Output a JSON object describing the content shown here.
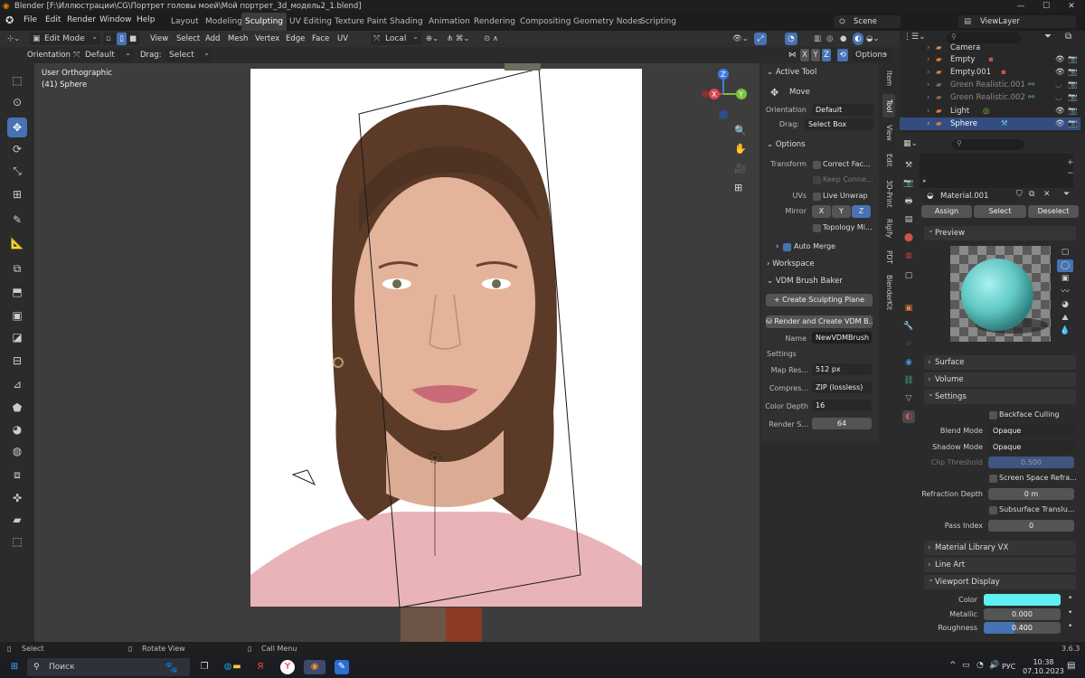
{
  "window": {
    "title": "Blender [F:\\Иллюстрации\\CG\\Портрет головы моей\\Мой портрет_3d_модель2_1.blend]",
    "minimize": "—",
    "maximize": "☐",
    "close": "✕"
  },
  "menu": [
    "File",
    "Edit",
    "Render",
    "Window",
    "Help"
  ],
  "workspaces": [
    "Layout",
    "Modeling",
    "Sculpting",
    "UV Editing",
    "Texture Paint",
    "Shading",
    "Animation",
    "Rendering",
    "Compositing",
    "Geometry Nodes",
    "Scripting"
  ],
  "active_workspace": "Sculpting",
  "scene": {
    "label": "Scene",
    "view_layer": "ViewLayer"
  },
  "header": {
    "mode": "Edit Mode",
    "menus": [
      "View",
      "Select",
      "Add",
      "Mesh",
      "Vertex",
      "Edge",
      "Face",
      "UV"
    ],
    "transform_orientation": "Local",
    "options_label": "Options",
    "axes": [
      "X",
      "Y",
      "Z"
    ]
  },
  "tool_settings": {
    "orientation_label": "Orientation:",
    "orientation_value": "Default",
    "drag_label": "Drag:",
    "drag_value": "Select Box"
  },
  "viewport": {
    "view_name": "User Orthographic",
    "object_info": "(41) Sphere"
  },
  "gizmo": {
    "x": "X",
    "y": "Y",
    "z": "Z"
  },
  "npanel": {
    "active_tool_title": "Active Tool",
    "tool_name": "Move",
    "orientation_label": "Orientation",
    "orientation_value": "Default",
    "drag_label": "Drag:",
    "drag_value": "Select Box",
    "options_title": "Options",
    "transform_label": "Transform",
    "correct_face": "Correct Fac...",
    "keep_connected": "Keep Conne...",
    "uvs_label": "UVs",
    "live_unwrap": "Live Unwrap",
    "mirror_label": "Mirror",
    "mirror_axes": [
      "X",
      "Y",
      "Z"
    ],
    "topology_mirror": "Topology Mi...",
    "auto_merge": "Auto Merge",
    "workspace_title": "Workspace",
    "vdm_title": "VDM Brush Baker",
    "create_plane": "Create Sculpting Plane",
    "render_vdm": "Render and Create VDM B...",
    "name_label": "Name",
    "name_value": "NewVDMBrush",
    "settings_label": "Settings",
    "map_res_label": "Map Res...",
    "map_res_value": "512 px",
    "compression_label": "Compres...",
    "compression_value": "ZIP (lossless)",
    "color_depth_label": "Color Depth",
    "color_depth_value": "16",
    "render_samples_label": "Render S...",
    "render_samples_value": "64"
  },
  "sidebar_tabs": [
    "Item",
    "Tool",
    "View",
    "Edit",
    "3D-Print",
    "Rigify",
    "PDT",
    "BlenderKit"
  ],
  "outliner": [
    {
      "name": "Camera",
      "color": "#c98e5a"
    },
    {
      "name": "Empty",
      "color": "#d0d0d0"
    },
    {
      "name": "Empty.001",
      "color": "#d0d0d0"
    },
    {
      "name": "Green Realistic.001",
      "color": "#8a8a8a"
    },
    {
      "name": "Green Realistic.002",
      "color": "#8a8a8a"
    },
    {
      "name": "Light",
      "color": "#d0d0d0"
    },
    {
      "name": "Sphere",
      "color": "#ffffff"
    }
  ],
  "properties": {
    "material_name": "Material.001",
    "assign": "Assign",
    "select": "Select",
    "deselect": "Deselect",
    "preview": "Preview",
    "surface": "Surface",
    "volume": "Volume",
    "settings": "Settings",
    "backface_culling": "Backface Culling",
    "blend_mode_label": "Blend Mode",
    "blend_mode_value": "Opaque",
    "shadow_mode_label": "Shadow Mode",
    "shadow_mode_value": "Opaque",
    "clip_threshold_label": "Clip Threshold",
    "clip_threshold_value": "0.500",
    "screen_space_refraction": "Screen Space Refra...",
    "refraction_depth_label": "Refraction Depth",
    "refraction_depth_value": "0 m",
    "subsurface_translucency": "Subsurface Translu...",
    "pass_index_label": "Pass Index",
    "pass_index_value": "0",
    "material_library": "Material Library VX",
    "line_art": "Line Art",
    "viewport_display": "Viewport Display",
    "color_label": "Color",
    "color_value": "#5ff0f2",
    "metallic_label": "Metallic",
    "metallic_value": "0.000",
    "roughness_label": "Roughness",
    "roughness_value": "0.400",
    "roughness_fraction": 0.4
  },
  "statusbar": {
    "select": "Select",
    "rotate": "Rotate View",
    "call_menu": "Call Menu",
    "version": "3.6.3"
  },
  "taskbar": {
    "search": "Поиск",
    "lang": "РУС",
    "time": "10:38",
    "date": "07.10.2023"
  }
}
